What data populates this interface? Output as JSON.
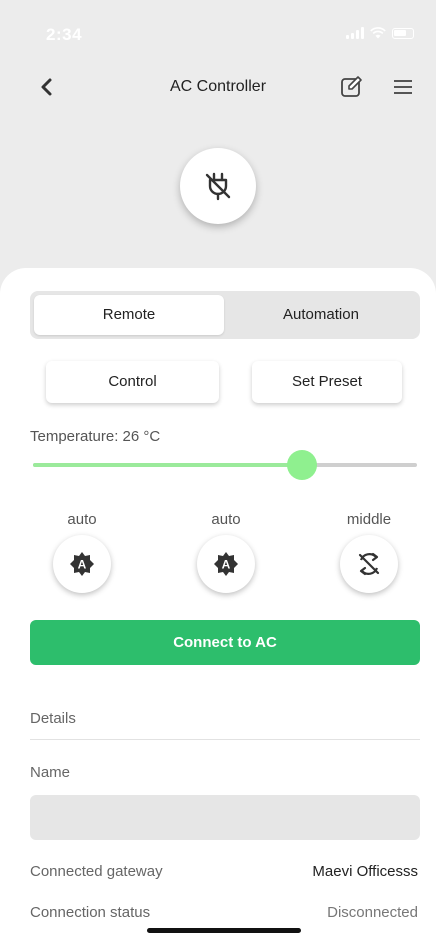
{
  "status_bar": {
    "time": "2:34"
  },
  "nav": {
    "title": "AC Controller",
    "back_icon": "chevron-left-icon",
    "edit_icon": "edit-icon",
    "menu_icon": "hamburger-menu-icon"
  },
  "device": {
    "icon": "plug-off-icon"
  },
  "tabs": [
    {
      "label": "Remote",
      "active": true
    },
    {
      "label": "Automation",
      "active": false
    }
  ],
  "sub_tabs": [
    {
      "label": "Control"
    },
    {
      "label": "Set Preset"
    }
  ],
  "temperature": {
    "label": "Temperature: 26 °C",
    "value": 26,
    "slider_fraction": 0.7
  },
  "modes": [
    {
      "label": "auto",
      "icon": "auto-mode-icon"
    },
    {
      "label": "auto",
      "icon": "auto-fan-icon"
    },
    {
      "label": "middle",
      "icon": "swing-off-icon"
    }
  ],
  "connect_button": {
    "label": "Connect to AC"
  },
  "details": {
    "header": "Details",
    "name_label": "Name",
    "name_value": "",
    "gateway_label": "Connected gateway",
    "gateway_value": "Maevi Officesss",
    "status_label": "Connection status",
    "status_value": "Disconnected"
  },
  "colors": {
    "accent_green": "#2dbe6c",
    "slider_green": "#8ff08f",
    "background": "#ececec"
  }
}
